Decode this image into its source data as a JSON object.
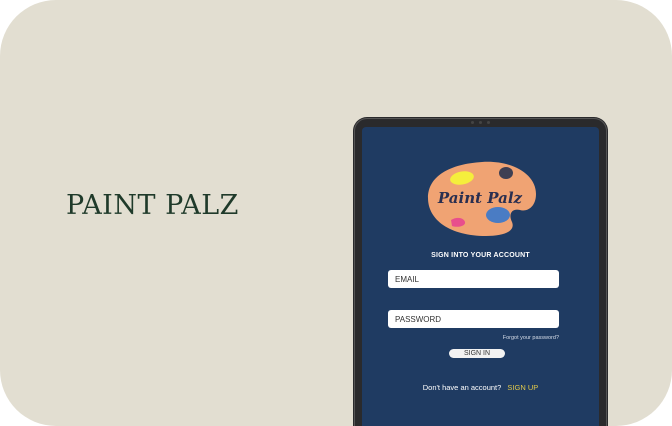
{
  "brand": {
    "title": "PAINT PALZ"
  },
  "app": {
    "logo_text": "Paint Palz",
    "heading": "SIGN INTO YOUR ACCOUNT",
    "email_placeholder": "EMAIL",
    "password_placeholder": "PASSWORD",
    "forgot_label": "Forgot your password?",
    "signin_label": "SIGN IN",
    "no_account_text": "Don't have an account?",
    "signup_label": "SIGN UP"
  },
  "colors": {
    "background": "#e2ded1",
    "screen": "#1f3b62",
    "palette": "#f0a373",
    "accent_link": "#e0c84a"
  }
}
